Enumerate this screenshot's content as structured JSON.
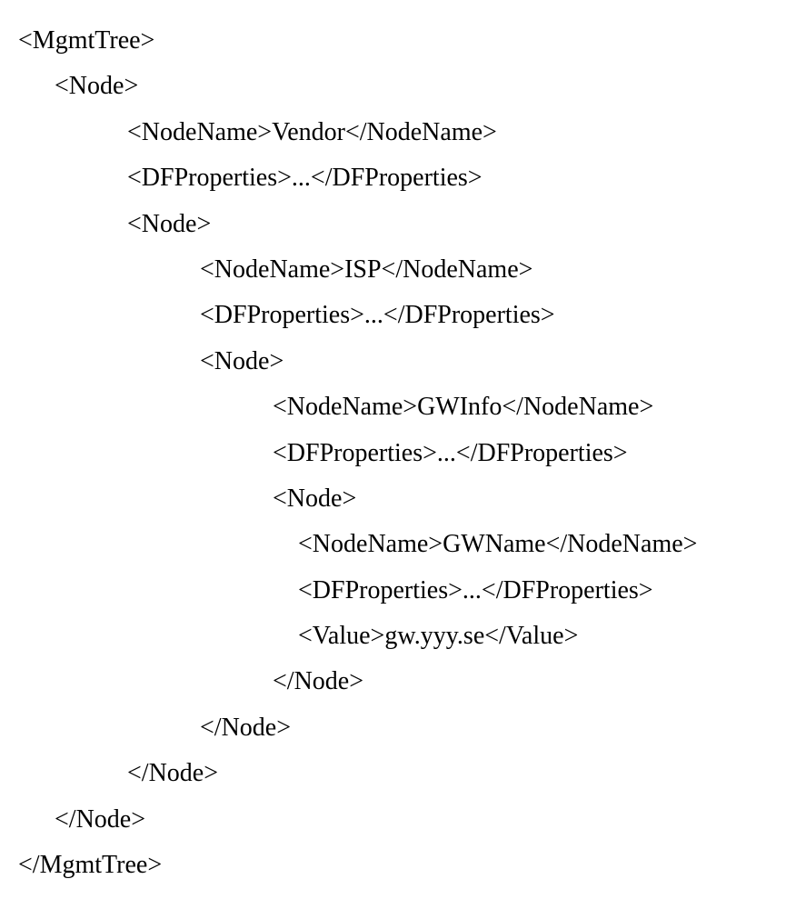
{
  "xml": {
    "lines": [
      {
        "indent": 0,
        "text": "<MgmtTree>"
      },
      {
        "indent": 1,
        "text": "<Node>"
      },
      {
        "indent": 2,
        "text": "<NodeName>Vendor</NodeName>"
      },
      {
        "indent": 2,
        "text": "<DFProperties>...</DFProperties>"
      },
      {
        "indent": 2,
        "text": "<Node>"
      },
      {
        "indent": 3,
        "text": "<NodeName>ISP</NodeName>"
      },
      {
        "indent": 3,
        "text": "<DFProperties>...</DFProperties>"
      },
      {
        "indent": 3,
        "text": "<Node>"
      },
      {
        "indent": 4,
        "text": "<NodeName>GWInfo</NodeName>"
      },
      {
        "indent": 4,
        "text": "<DFProperties>...</DFProperties>"
      },
      {
        "indent": 4,
        "text": "<Node>"
      },
      {
        "indent": 4,
        "text": "    <NodeName>GWName</NodeName>"
      },
      {
        "indent": 4,
        "text": "    <DFProperties>...</DFProperties>"
      },
      {
        "indent": 4,
        "text": "    <Value>gw.yyy.se</Value>"
      },
      {
        "indent": 4,
        "text": "</Node>"
      },
      {
        "indent": 3,
        "text": "</Node>"
      },
      {
        "indent": 2,
        "text": "</Node>"
      },
      {
        "indent": 1,
        "text": "</Node>"
      },
      {
        "indent": 0,
        "text": "</MgmtTree>"
      }
    ]
  }
}
